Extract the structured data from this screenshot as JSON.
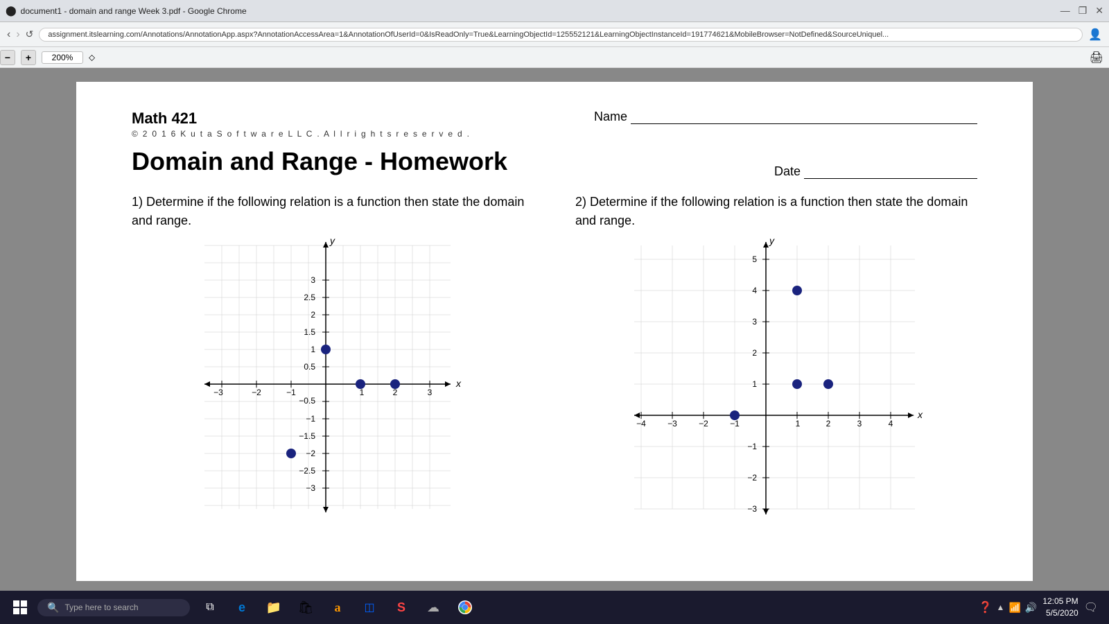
{
  "browser": {
    "title": "document1 - domain and range Week 3.pdf - Google Chrome",
    "url": "assignment.itslearning.com/Annotations/AnnotationApp.aspx?AnnotationAccessArea=1&AnnotationOfUserId=0&IsReadOnly=True&LearningObjectId=125552121&LearningObjectInstanceId=191774621&MobileBrowser=NotDefined&SourceUniquel...",
    "zoom": "200%",
    "zoom_minus": "−",
    "zoom_plus": "+"
  },
  "document": {
    "course": "Math 421",
    "copyright": "©  2 0 1 6  K u t a   S o f t w a r e   L L C .    A l l   r i g h t s  r e s e r v e d .",
    "hw_title": "Domain and Range - Homework",
    "name_label": "Name",
    "date_label": "Date",
    "problem1": {
      "number": "1)",
      "text": "Determine if the following relation is a function then state the domain and range."
    },
    "problem2": {
      "number": "2)",
      "text": "Determine if the following relation is a function then state the domain and range."
    }
  },
  "taskbar": {
    "search_placeholder": "Type here to search",
    "clock_time": "12:05 PM",
    "clock_date": "5/5/2020"
  },
  "icons": {
    "windows": "⊞",
    "search": "🔍",
    "task_view": "⧉",
    "edge": "e",
    "file_explorer": "📁",
    "store": "🛍",
    "amazon": "a",
    "dropbox": "◫",
    "stylus": "S",
    "onedrive": "☁",
    "chrome": "●",
    "help": "?",
    "network": "📶",
    "volume": "🔊",
    "notification": "🔔",
    "print": "🖨"
  }
}
